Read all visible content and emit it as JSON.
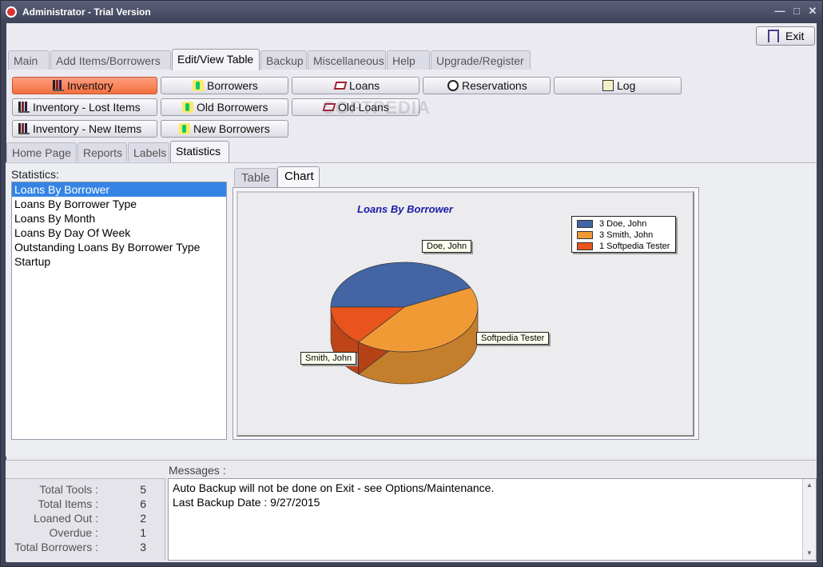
{
  "window": {
    "title": "Administrator - Trial Version"
  },
  "exit_label": "Exit",
  "main_tabs": [
    {
      "label": "Main"
    },
    {
      "label": "Add Items/Borrowers"
    },
    {
      "label": "Edit/View Table"
    },
    {
      "label": "Backup"
    },
    {
      "label": "Miscellaneous"
    },
    {
      "label": "Help"
    },
    {
      "label": "Upgrade/Register"
    }
  ],
  "table_buttons": [
    {
      "label": "Inventory",
      "icon": "books-icon"
    },
    {
      "label": "Borrowers",
      "icon": "person-icon"
    },
    {
      "label": "Loans",
      "icon": "loans-icon"
    },
    {
      "label": "Reservations",
      "icon": "clock-icon"
    },
    {
      "label": "Log",
      "icon": "log-icon"
    },
    {
      "label": "Inventory - Lost Items",
      "icon": "books-icon"
    },
    {
      "label": "Old Borrowers",
      "icon": "person-icon"
    },
    {
      "label": "Old Loans",
      "icon": "loans-icon"
    },
    {
      "label": "Inventory - New Items",
      "icon": "books-icon"
    },
    {
      "label": "New Borrowers",
      "icon": "person-icon"
    }
  ],
  "sub_tabs": [
    {
      "label": "Home Page"
    },
    {
      "label": "Reports"
    },
    {
      "label": "Labels"
    },
    {
      "label": "Statistics"
    }
  ],
  "statistics": {
    "label": "Statistics:",
    "items": [
      "Loans By Borrower",
      "Loans By Borrower Type",
      "Loans By Month",
      "Loans By Day Of Week",
      "Outstanding Loans By Borrower Type",
      "Startup"
    ]
  },
  "chart_tabs": [
    {
      "label": "Table"
    },
    {
      "label": "Chart"
    }
  ],
  "chart_data": {
    "type": "pie",
    "title": "Loans By Borrower",
    "categories": [
      "Doe, John",
      "Smith, John",
      "Softpedia Tester"
    ],
    "values": [
      3,
      3,
      1
    ],
    "colors": [
      "#4465a3",
      "#f09a36",
      "#e8541c"
    ],
    "legend": [
      "3 Doe, John",
      "3 Smith, John",
      "1 Softpedia Tester"
    ],
    "legend_position": "top-right"
  },
  "messages": {
    "label": "Messages :",
    "lines": [
      "Auto Backup will not be done on Exit - see Options/Maintenance.",
      "Last Backup Date : 9/27/2015"
    ]
  },
  "totals": [
    {
      "label": "Total Tools :",
      "value": "5"
    },
    {
      "label": "Total Items :",
      "value": "6"
    },
    {
      "label": "Loaned Out :",
      "value": "2"
    },
    {
      "label": "Overdue :",
      "value": "1"
    },
    {
      "label": "Total Borrowers :",
      "value": "3"
    }
  ]
}
